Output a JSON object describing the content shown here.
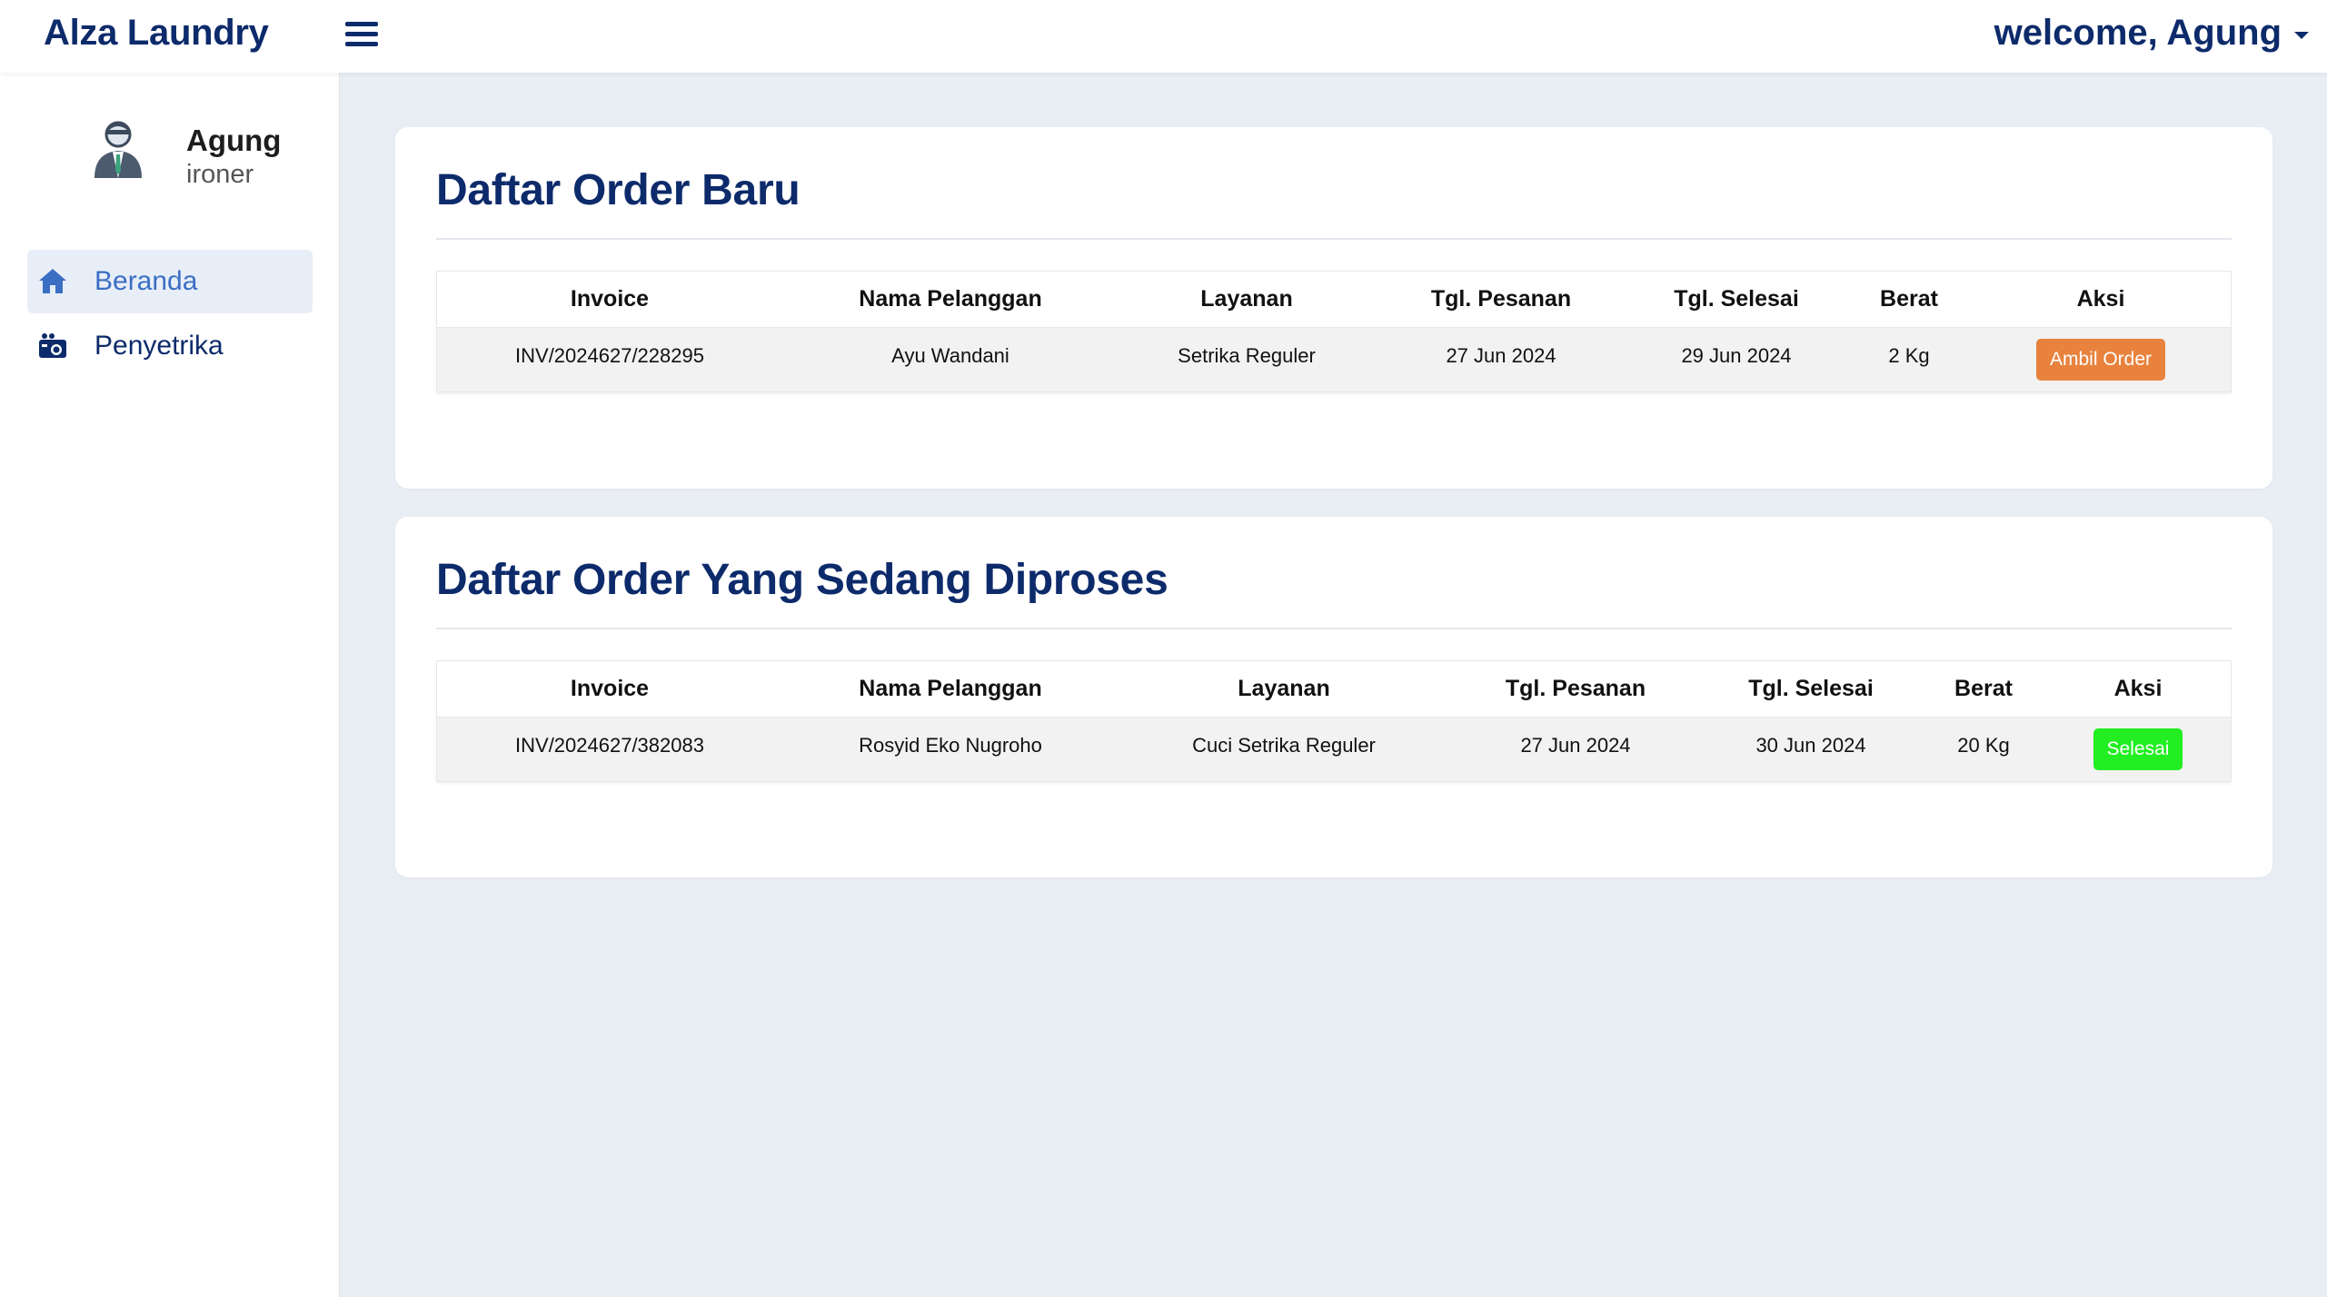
{
  "header": {
    "brand": "Alza Laundry",
    "welcome": "welcome, Agung"
  },
  "sidebar": {
    "profile": {
      "name": "Agung",
      "role": "ironer"
    },
    "items": [
      {
        "label": "Beranda",
        "icon": "home-icon",
        "active": true
      },
      {
        "label": "Penyetrika",
        "icon": "laundry-icon",
        "active": false
      }
    ]
  },
  "new_orders": {
    "title": "Daftar Order Baru",
    "headers": [
      "Invoice",
      "Nama Pelanggan",
      "Layanan",
      "Tgl. Pesanan",
      "Tgl. Selesai",
      "Berat",
      "Aksi"
    ],
    "rows": [
      {
        "invoice": "INV/2024627/228295",
        "customer": "Ayu Wandani",
        "service": "Setrika Reguler",
        "order_date": "27 Jun 2024",
        "finish_date": "29 Jun 2024",
        "weight": "2 Kg",
        "action": "Ambil Order"
      }
    ],
    "action_color": "#e8823d"
  },
  "processing_orders": {
    "title": "Daftar Order Yang Sedang Diproses",
    "headers": [
      "Invoice",
      "Nama Pelanggan",
      "Layanan",
      "Tgl. Pesanan",
      "Tgl. Selesai",
      "Berat",
      "Aksi"
    ],
    "rows": [
      {
        "invoice": "INV/2024627/382083",
        "customer": "Rosyid Eko Nugroho",
        "service": "Cuci Setrika Reguler",
        "order_date": "27 Jun 2024",
        "finish_date": "30 Jun 2024",
        "weight": "20 Kg",
        "action": "Selesai"
      }
    ],
    "action_color": "#22ee22"
  },
  "colors": {
    "brand": "#0d2b6b",
    "active_nav": "#3a6fc4",
    "background": "#e9eef4"
  }
}
